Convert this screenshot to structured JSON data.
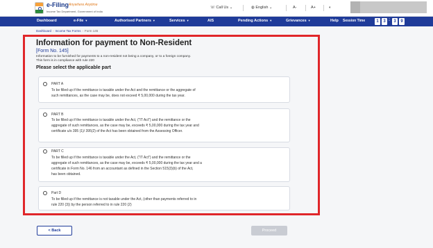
{
  "header": {
    "brand_title": "e-Filing",
    "brand_tagline": "Anywhere Anytime",
    "brand_subtitle": "Income Tax Department, Government of India",
    "call_us": "Call Us",
    "language": "English",
    "font_decrease": "A-",
    "font_increase": "A+"
  },
  "nav": {
    "items": [
      {
        "label": "Dashboard",
        "has_menu": false
      },
      {
        "label": "e-File",
        "has_menu": true
      },
      {
        "label": "Authorised Partners",
        "has_menu": true
      },
      {
        "label": "Services",
        "has_menu": true
      },
      {
        "label": "AIS",
        "has_menu": false
      },
      {
        "label": "Pending Actions",
        "has_menu": true
      },
      {
        "label": "Grievances",
        "has_menu": true
      },
      {
        "label": "Help",
        "has_menu": false
      }
    ],
    "session_label": "Session Time",
    "session_digits": [
      "1",
      "3",
      "3",
      "9"
    ]
  },
  "breadcrumb": {
    "items": [
      "Dashboard",
      "Income Tax Forms",
      "Form 145"
    ]
  },
  "page": {
    "title": "Information for payment to Non-Resident",
    "form_no": "[Form No. 145]",
    "description_1": "Information to be furnished for payments to a non-resident not being a company, or to a foreign company.",
    "description_2": "This form is in compliance with rule 220",
    "select_label": "Please select the applicable part"
  },
  "options": [
    {
      "title": "PART A",
      "lines": [
        "To be filled up if the remittance is taxable under the Act  and the remittance or the aggregate of",
        "such remittances, as the case may be, does not exceed ₹ 5,00,000 during the tax year."
      ]
    },
    {
      "title": "PART B",
      "lines": [
        "To be filled up if the remittance is taxable under the Act, (\"IT Act\")  and the remittance or the",
        "aggregate of such remittances, as the case may be, exceeds ₹ 5,00,000 during the tax year and",
        "certificate u/s 395 (1)/ 395(2) of the Act has been obtained from the Assessing Officer."
      ]
    },
    {
      "title": "PART C",
      "lines": [
        "To be filled up if the remittance is taxable under the Act, (\"IT Act\")  and the remittance or the",
        "aggregate of such remittances, as the case may be, exceeds ₹ 5,00,000 during the tax year and a",
        "certificate in Form No. 146 from an accountant as defined in the Section 515(3)(b) of the Act,",
        "has been obtained."
      ]
    },
    {
      "title": "Part D",
      "lines": [
        "To be filled up if the remittance is not taxable under the Act, (other than payments referred to in",
        "rule 220 (3)) by the person referred to in rule 220 (2)"
      ]
    }
  ],
  "actions": {
    "back_label": "< Back",
    "proceed_label": "Proceed"
  },
  "colors": {
    "nav_bg": "#1f3b99",
    "highlight_border": "#e0262a",
    "accent": "#1f3b99",
    "disabled_button": "#c9ccd3"
  }
}
